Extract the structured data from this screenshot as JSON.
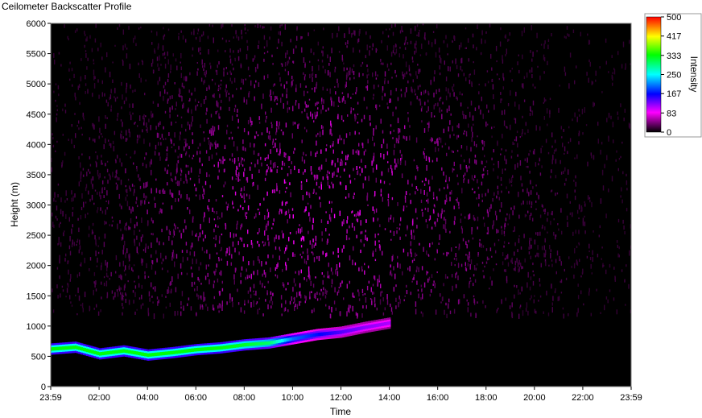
{
  "window": {
    "title": "Ceilometer Backscatter Profile"
  },
  "chart_data": {
    "type": "heatmap",
    "title": "",
    "xlabel": "Time",
    "ylabel": "Height (m)",
    "x_ticks": [
      "23:59",
      "02:00",
      "04:00",
      "06:00",
      "08:00",
      "10:00",
      "12:00",
      "14:00",
      "16:00",
      "18:00",
      "20:00",
      "22:00",
      "23:59"
    ],
    "y_ticks": [
      0,
      500,
      1000,
      1500,
      2000,
      2500,
      3000,
      3500,
      4000,
      4500,
      5000,
      5500,
      6000
    ],
    "ylim": [
      0,
      6000
    ],
    "grid": false,
    "colorbar": {
      "label": "Intensity",
      "range": [
        0,
        500
      ],
      "ticks": [
        0,
        83,
        167,
        250,
        333,
        417,
        500
      ],
      "placement": "right",
      "colors": [
        "#000000",
        "#ff00ff",
        "#0000ff",
        "#00ffff",
        "#00ff00",
        "#ffff00",
        "#ff0000"
      ]
    },
    "cloud_layer": {
      "times": [
        "00:00",
        "01:00",
        "02:00",
        "03:00",
        "04:00",
        "05:00",
        "06:00",
        "07:00",
        "08:00",
        "09:00",
        "10:00",
        "11:00",
        "12:00",
        "13:00",
        "14:00"
      ],
      "height_m": [
        620,
        650,
        540,
        590,
        520,
        560,
        610,
        640,
        690,
        720,
        790,
        860,
        900,
        980,
        1050
      ],
      "intensity": [
        330,
        330,
        330,
        330,
        330,
        330,
        330,
        330,
        320,
        300,
        200,
        170,
        140,
        120,
        110
      ]
    },
    "noise_region": {
      "height_range_m": [
        1200,
        6000
      ],
      "peak_intensity": 90,
      "peak_time": "11:00",
      "peak_height_m": 3000
    }
  }
}
